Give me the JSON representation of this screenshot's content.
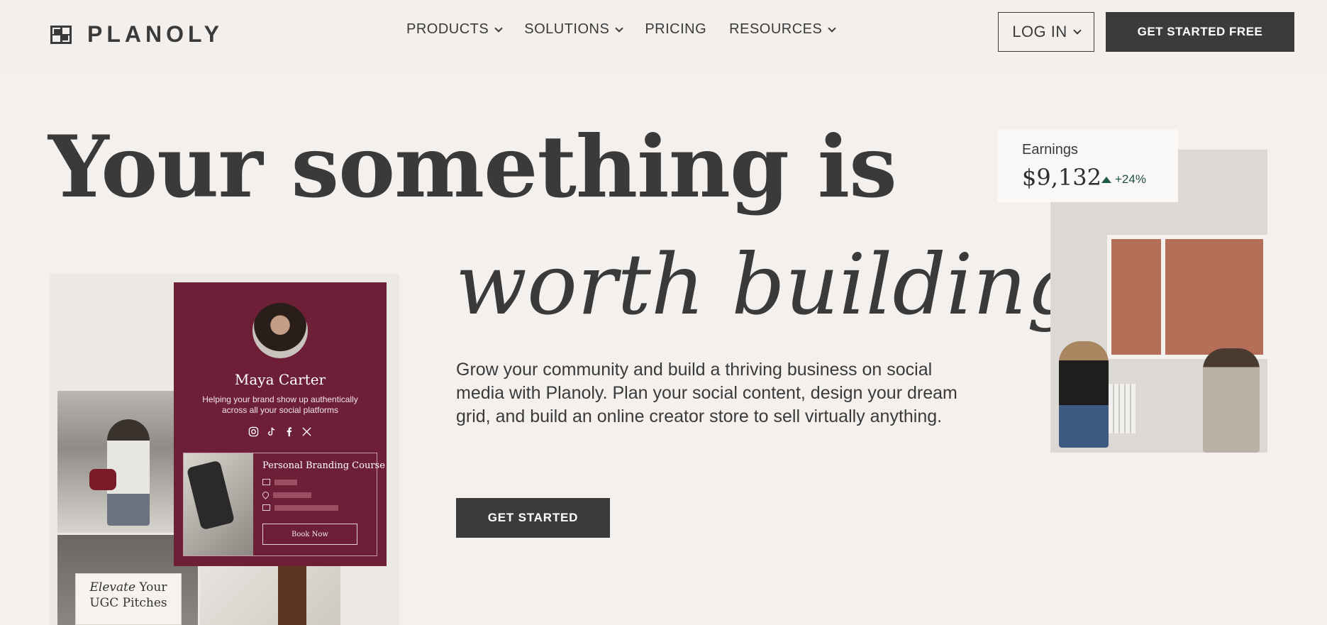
{
  "brand": {
    "name": "PLANOLY"
  },
  "nav": {
    "items": [
      {
        "label": "PRODUCTS",
        "dropdown": true
      },
      {
        "label": "SOLUTIONS",
        "dropdown": true
      },
      {
        "label": "PRICING",
        "dropdown": false
      },
      {
        "label": "RESOURCES",
        "dropdown": true
      }
    ],
    "login_label": "LOG IN",
    "cta_label": "GET STARTED FREE"
  },
  "hero": {
    "headline_line1": "Your something is",
    "headline_line2": "worth building",
    "lead": "Grow your community and build a thriving business on social media with Planoly. Plan your social content, design your dream grid, and build an online creator store to sell virtually anything.",
    "cta_label": "GET STARTED"
  },
  "profile_card": {
    "name": "Maya Carter",
    "description": "Helping your brand show up authentically across all your social platforms",
    "socials": [
      "instagram-icon",
      "tiktok-icon",
      "facebook-icon",
      "x-icon"
    ],
    "course_title": "Personal Branding Course",
    "book_label": "Book Now",
    "color": "#6d1f38"
  },
  "ugc_card": {
    "line1_italic": "Elevate",
    "line1_rest": " Your",
    "line2": "UGC Pitches"
  },
  "earnings": {
    "label": "Earnings",
    "value": "$9,132",
    "delta": "+24%",
    "delta_color": "#1f5a4a"
  },
  "colors": {
    "background": "#f3f0ed",
    "button_dark": "#3b3b3b",
    "text": "#3a3a3a"
  }
}
